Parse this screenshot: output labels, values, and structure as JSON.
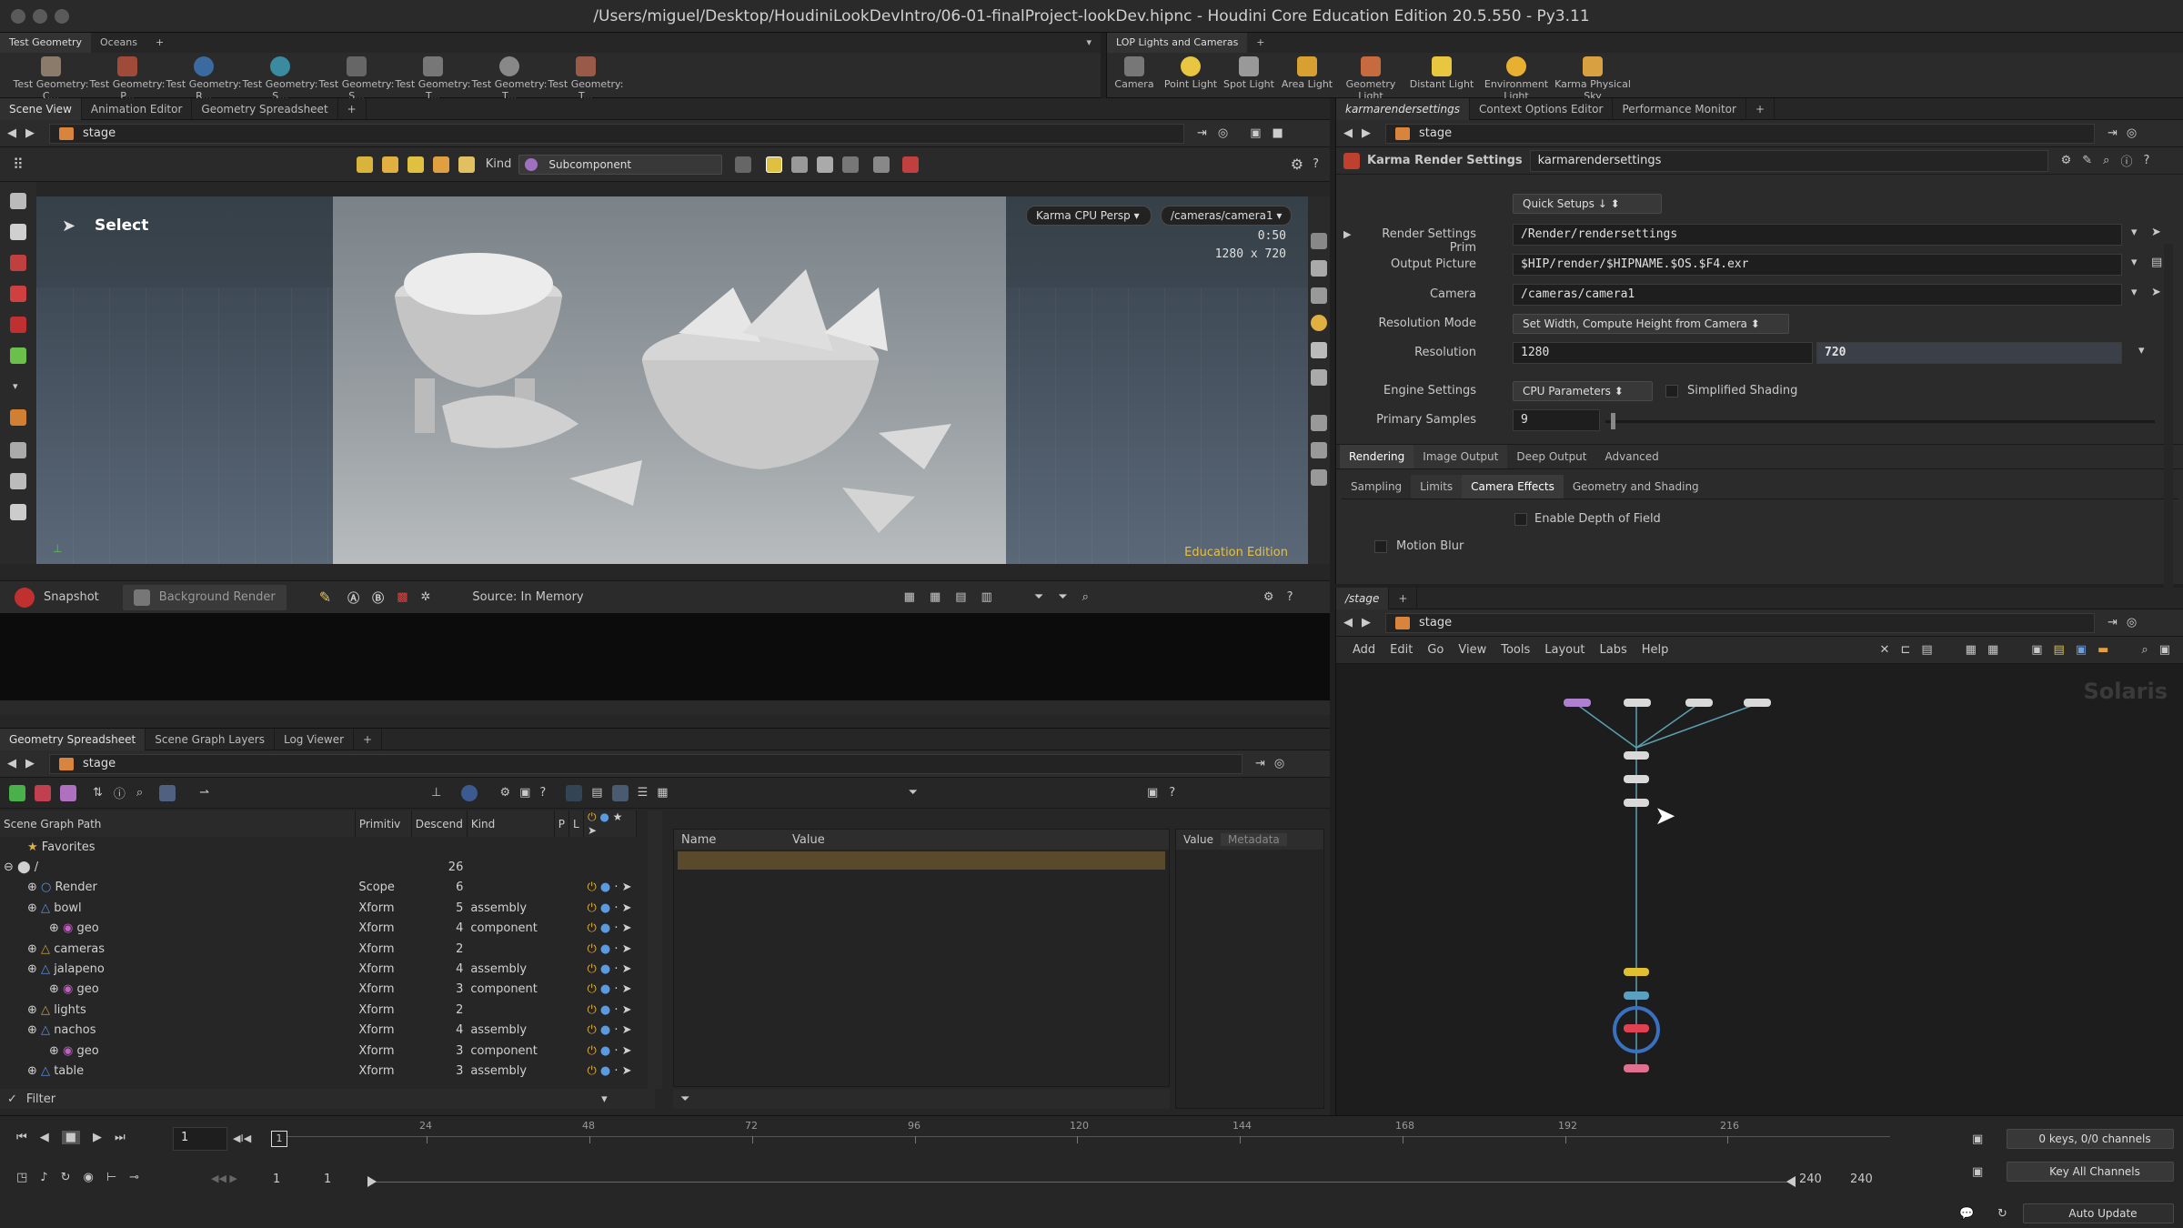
{
  "window": {
    "title": "/Users/miguel/Desktop/HoudiniLookDevIntro/06-01-finalProject-lookDev.hipnc - Houdini Core Education Edition 20.5.550 - Py3.11"
  },
  "shelf_left": {
    "tabs": [
      "Test Geometry",
      "Oceans"
    ],
    "tools": [
      "Test Geometry: C...",
      "Test Geometry: P...",
      "Test Geometry: R...",
      "Test Geometry: S...",
      "Test Geometry: S...",
      "Test Geometry: T...",
      "Test Geometry: T...",
      "Test Geometry: T..."
    ]
  },
  "shelf_right": {
    "tabs": [
      "LOP Lights and Cameras"
    ],
    "tools": [
      "Camera",
      "Point Light",
      "Spot Light",
      "Area Light",
      "Geometry Light",
      "Distant Light",
      "Environment Light",
      "Karma Physical Sky"
    ]
  },
  "viewport_panel": {
    "tabs": [
      "Scene View",
      "Animation Editor",
      "Geometry Spreadsheet"
    ],
    "path": "stage",
    "kind_label": "Kind",
    "kind_value": "Subcomponent",
    "select_label": "Select",
    "renderer": "Karma CPU Persp",
    "camera": "/cameras/camera1",
    "render_time": "0:50",
    "resolution": "1280 x 720",
    "edition": "Education Edition",
    "snapshot": "Snapshot",
    "background_render": "Background Render",
    "source": "Source: In Memory"
  },
  "params_panel": {
    "tabs": [
      "karmarendersettings",
      "Context Options Editor",
      "Performance Monitor"
    ],
    "path": "stage",
    "node_type": "Karma Render Settings",
    "node_name": "karmarendersettings",
    "quick_setup_label": "Quick Setup",
    "quick_setup_value": "Quick Setups",
    "render_settings_prim_label": "Render Settings Prim",
    "render_settings_prim_value": "/Render/rendersettings",
    "output_picture_label": "Output Picture",
    "output_picture_value": "$HIP/render/$HIPNAME.$OS.$F4.exr",
    "camera_label": "Camera",
    "camera_value": "/cameras/camera1",
    "resolution_mode_label": "Resolution Mode",
    "resolution_mode_value": "Set Width, Compute Height from Camera",
    "resolution_label": "Resolution",
    "resolution_w": "1280",
    "resolution_h": "720",
    "engine_settings_label": "Engine Settings",
    "engine_settings_value": "CPU Parameters",
    "simplified_shading": "Simplified Shading",
    "primary_samples_label": "Primary Samples",
    "primary_samples_value": "9",
    "primary_samples_fraction": 0.01,
    "main_tabs": [
      "Rendering",
      "Image Output",
      "Deep Output",
      "Advanced"
    ],
    "sub_tabs": [
      "Sampling",
      "Limits",
      "Camera Effects",
      "Geometry and Shading"
    ],
    "enable_dof": "Enable Depth of Field",
    "motion_blur": "Motion Blur"
  },
  "network_panel": {
    "tabs": [
      "/stage"
    ],
    "path": "stage",
    "menu": [
      "Add",
      "Edit",
      "Go",
      "View",
      "Tools",
      "Layout",
      "Labs",
      "Help"
    ],
    "context_label": "Solaris"
  },
  "scene_graph": {
    "tabs": [
      "Geometry Spreadsheet",
      "Scene Graph Layers",
      "Log Viewer"
    ],
    "path": "stage",
    "columns": [
      "Scene Graph Path",
      "Primitiv",
      "Descend",
      "Kind",
      "P",
      "L"
    ],
    "favorites": "Favorites",
    "root": {
      "name": "/",
      "descendants": "26"
    },
    "rows": [
      {
        "name": "Render",
        "type": "Scope",
        "desc": "6",
        "kind": ""
      },
      {
        "name": "bowl",
        "type": "Xform",
        "desc": "5",
        "kind": "assembly"
      },
      {
        "name": "geo",
        "type": "Xform",
        "desc": "4",
        "kind": "component"
      },
      {
        "name": "cameras",
        "type": "Xform",
        "desc": "2",
        "kind": ""
      },
      {
        "name": "jalapeno",
        "type": "Xform",
        "desc": "4",
        "kind": "assembly"
      },
      {
        "name": "geo",
        "type": "Xform",
        "desc": "3",
        "kind": "component"
      },
      {
        "name": "lights",
        "type": "Xform",
        "desc": "2",
        "kind": ""
      },
      {
        "name": "nachos",
        "type": "Xform",
        "desc": "4",
        "kind": "assembly"
      },
      {
        "name": "geo",
        "type": "Xform",
        "desc": "3",
        "kind": "component"
      },
      {
        "name": "table",
        "type": "Xform",
        "desc": "3",
        "kind": "assembly"
      }
    ],
    "filter_label": "Filter",
    "props_columns": [
      "Name",
      "Value"
    ],
    "value_tabs": [
      "Value",
      "Metadata"
    ]
  },
  "timeline": {
    "frame": "1",
    "ticks": [
      "24",
      "48",
      "72",
      "96",
      "120",
      "144",
      "168",
      "192",
      "216"
    ],
    "current": "1",
    "start": "1",
    "range_start": "1",
    "end": "240",
    "range_end": "240",
    "keys": "0 keys, 0/0 channels",
    "key_all": "Key All Channels",
    "auto_update": "Auto Update"
  }
}
